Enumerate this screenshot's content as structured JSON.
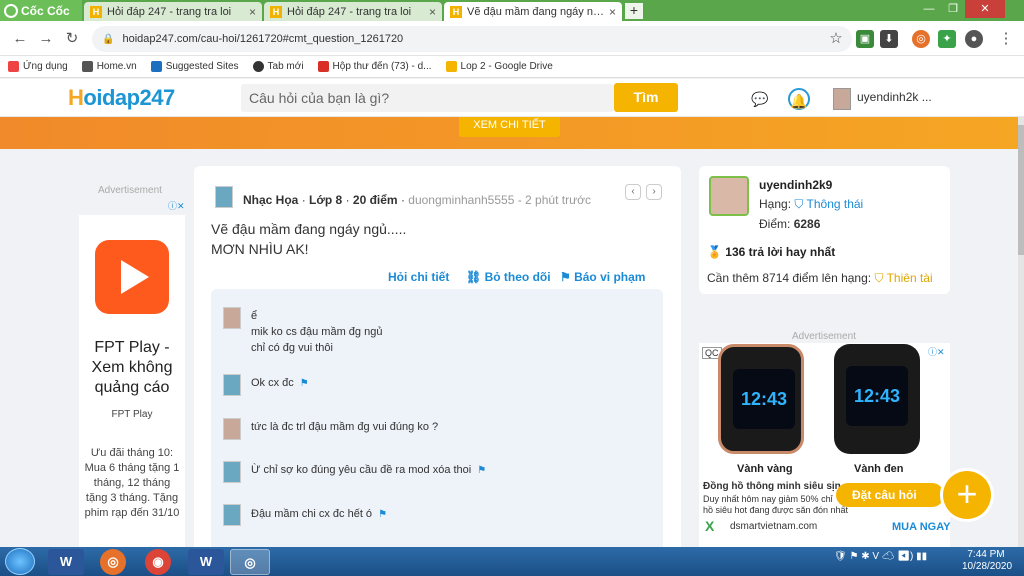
{
  "browser": {
    "brand": "Cốc Cốc",
    "tabs": [
      {
        "title": "Hỏi đáp 247 - trang tra loi",
        "active": false
      },
      {
        "title": "Hỏi đáp 247 - trang tra loi",
        "active": false
      },
      {
        "title": "Vẽ đậu mầm đang ngáy ngủ...",
        "active": true
      }
    ],
    "new_tab": "+",
    "url": "hoidap247.com/cau-hoi/1261720#cmt_question_1261720",
    "bookmarks": [
      "Ứng dụng",
      "Home.vn",
      "Suggested Sites",
      "Tab mới",
      "Hộp thư đến (73) - d...",
      "Lop 2 - Google Drive"
    ]
  },
  "site": {
    "logo": "Hoidap247",
    "search_placeholder": "Câu hỏi của bạn là gì?",
    "search_button": "Tìm",
    "username": "uyendinh2k ...",
    "banner_button": "XEM CHI TIẾT"
  },
  "left_ad": {
    "label": "Advertisement",
    "title": "FPT Play - Xem không quảng cáo",
    "source": "FPT Play",
    "desc": "Ưu đãi tháng 10: Mua 6 tháng tặng 1 tháng, 12 tháng tặng 3 tháng. Tặng phim rạp đến 31/10"
  },
  "question": {
    "subject": "Nhạc Họa",
    "grade": "Lớp 8",
    "points": "20 điểm",
    "author": "duongminhanh5555 - 2 phút trước",
    "line1": "Vẽ đậu mầm đang ngáy ngủ.....",
    "line2": "MƠN NHÌU AK!",
    "actions": [
      "Hỏi chi tiết",
      "Bỏ theo dõi",
      "Báo vi phạm"
    ],
    "comments": [
      {
        "lines": [
          "ể",
          "mik ko cs đậu mầm đg ngủ",
          "chỉ có đg vui thôi"
        ],
        "flag": false
      },
      {
        "lines": [
          "Ok cx đc"
        ],
        "flag": true
      },
      {
        "lines": [
          "tức là đc trl đậu mầm đg vui đúng ko ?"
        ],
        "flag": false
      },
      {
        "lines": [
          "Ừ chỉ sợ ko đúng yêu cầu đề ra mod xóa thoi"
        ],
        "flag": true
      },
      {
        "lines": [
          "Đậu mầm chi cx đc hết ó"
        ],
        "flag": true
      }
    ]
  },
  "profile": {
    "name": "uyendinh2k9",
    "rank_label": "Hạng:",
    "rank_value": "Thông thái",
    "points_label": "Điểm:",
    "points_value": "6286",
    "best_answers": "136 trả lời hay nhất",
    "need_text": "Cần thêm 8714 điểm lên hạng:",
    "next_rank": "Thiên tài"
  },
  "right_ad": {
    "label": "Advertisement",
    "badge": "QC",
    "watch1_time": "12:43",
    "watch2_time": "12:43",
    "caption1": "Vành vàng",
    "caption2": "Vành đen",
    "headline": "Đồng hồ thông minh siêu sịn",
    "line1": "Duy nhất hôm nay giảm 50% chỉ",
    "line2": "hồ siêu hot đang được săn đón nhất",
    "domain": "dsmartvietnam.com",
    "cta": "MUA NGAY"
  },
  "ask_button": "Đặt câu hỏi",
  "taskbar": {
    "time": "7:44 PM",
    "date": "10/28/2020"
  }
}
